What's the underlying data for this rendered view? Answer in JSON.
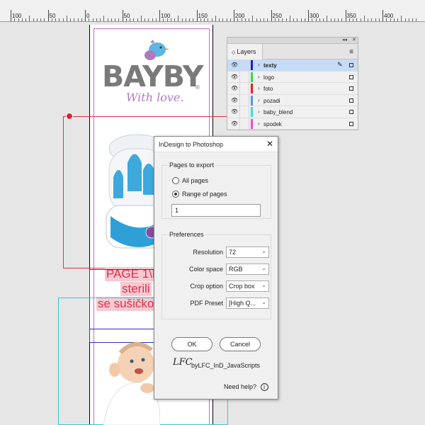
{
  "ruler": {
    "labels": [
      "100",
      "50",
      "0",
      "50",
      "100",
      "150",
      "200",
      "250",
      "300",
      "350",
      "400"
    ]
  },
  "logo": {
    "word": "BAYBY",
    "tagline": "With love.",
    "registered": "®"
  },
  "page_text": {
    "line1": "PAGE 1\\D",
    "line2": "sterili",
    "line3": "se sušičko"
  },
  "layers_panel": {
    "tab": "Layers",
    "items": [
      {
        "name": "texty",
        "color": "#1a1ad0",
        "selected": true
      },
      {
        "name": "logo",
        "color": "#3dd64a"
      },
      {
        "name": "foto",
        "color": "#e02020"
      },
      {
        "name": "pozadi",
        "color": "#5a8ff0"
      },
      {
        "name": "baby_blend",
        "color": "#33dddd"
      },
      {
        "name": "spodek",
        "color": "#e84ae8"
      }
    ]
  },
  "dialog": {
    "title": "InDesign to Photoshop",
    "pages_group": "Pages to export",
    "all_pages": "All pages",
    "range_pages": "Range of pages",
    "range_value": "1",
    "prefs_group": "Preferences",
    "resolution_label": "Resolution",
    "resolution_value": "72",
    "colorspace_label": "Color space",
    "colorspace_value": "RGB",
    "crop_label": "Crop option",
    "crop_value": "Crop box",
    "pdf_label": "PDF Preset",
    "pdf_value": "[High Q...",
    "ok": "OK",
    "cancel": "Cancel",
    "brand_logo": "LFC",
    "brand_text": "byLFC_InD_JavaScripts",
    "help": "Need help?"
  }
}
